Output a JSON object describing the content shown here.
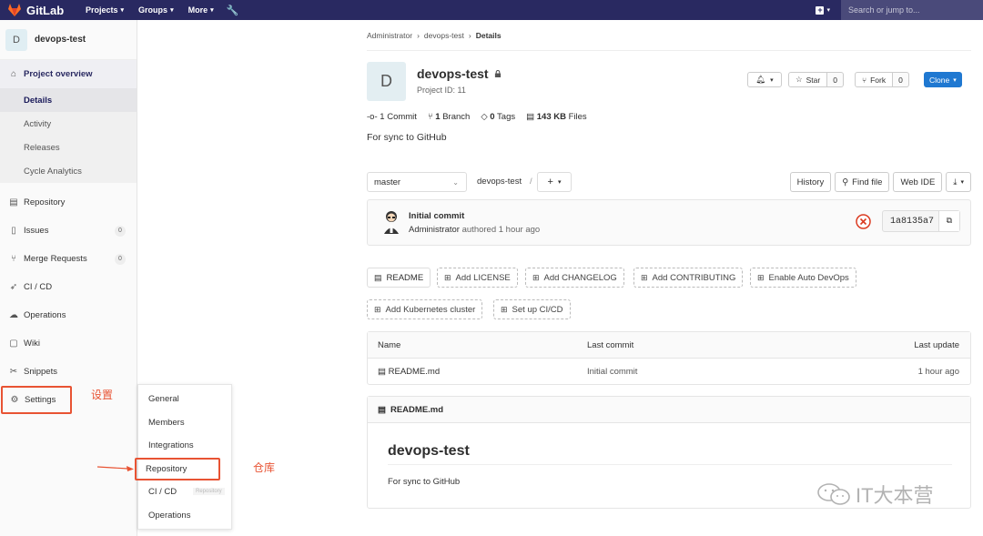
{
  "topnav": {
    "brand": "GitLab",
    "projects": "Projects",
    "groups": "Groups",
    "more": "More",
    "search_placeholder": "Search or jump to..."
  },
  "sidebar": {
    "project_initial": "D",
    "project_name": "devops-test",
    "overview": "Project overview",
    "sub_items": [
      "Details",
      "Activity",
      "Releases",
      "Cycle Analytics"
    ],
    "repository": "Repository",
    "issues": "Issues",
    "issues_count": "0",
    "merge_requests": "Merge Requests",
    "mr_count": "0",
    "cicd": "CI / CD",
    "operations": "Operations",
    "wiki": "Wiki",
    "snippets": "Snippets",
    "settings": "Settings"
  },
  "flyout": {
    "items": [
      "General",
      "Members",
      "Integrations",
      "Repository",
      "CI / CD",
      "Operations"
    ],
    "tooltip": "Repository"
  },
  "annotations": {
    "settings_note": "设置",
    "repo_note": "仓库"
  },
  "breadcrumb": [
    "Administrator",
    "devops-test",
    "Details"
  ],
  "project": {
    "initial": "D",
    "title": "devops-test",
    "id_text": "Project ID: 11",
    "star_label": "Star",
    "star_count": "0",
    "fork_label": "Fork",
    "fork_count": "0",
    "clone_label": "Clone",
    "stats": {
      "commits": "1",
      "commits_label": "Commit",
      "branches": "1",
      "branches_label": "Branch",
      "tags": "0",
      "tags_label": "Tags",
      "size": "143 KB",
      "size_label": "Files"
    },
    "description": "For sync to GitHub"
  },
  "toolbar": {
    "branch": "master",
    "path": "devops-test",
    "slash": "/",
    "history": "History",
    "find_file": "Find file",
    "web_ide": "Web IDE"
  },
  "commit": {
    "title": "Initial commit",
    "author": "Administrator",
    "meta": "authored 1 hour ago",
    "sha": "1a8135a7"
  },
  "quick_actions": [
    "README",
    "Add LICENSE",
    "Add CHANGELOG",
    "Add CONTRIBUTING",
    "Enable Auto DevOps",
    "Add Kubernetes cluster",
    "Set up CI/CD"
  ],
  "file_tree": {
    "headers": [
      "Name",
      "Last commit",
      "Last update"
    ],
    "rows": [
      {
        "name": "README.md",
        "commit": "Initial commit",
        "updated": "1 hour ago"
      }
    ]
  },
  "readme": {
    "file": "README.md",
    "heading": "devops-test",
    "body": "For sync to GitHub"
  },
  "watermark": "IT大本营",
  "colors": {
    "nav_bg": "#292961",
    "accent_blue": "#1f78d1",
    "annotation_red": "#e85333"
  }
}
